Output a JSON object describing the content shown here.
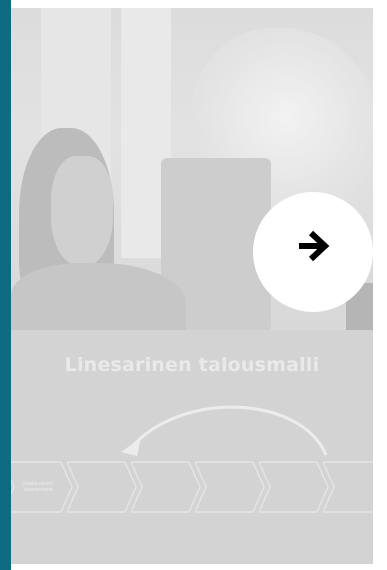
{
  "slide": {
    "diagram_title": "Linesarinen talousmalli",
    "steps": [
      "Raaka-aineet\nluonnonvarat",
      "",
      "",
      "",
      "",
      ""
    ]
  },
  "next_button": {
    "icon": "arrow-right-icon"
  },
  "colors": {
    "accent_bar": "#0e6b80",
    "overlay": "#d3d3d3",
    "button_bg": "#ffffff",
    "arrow": "#000000"
  }
}
